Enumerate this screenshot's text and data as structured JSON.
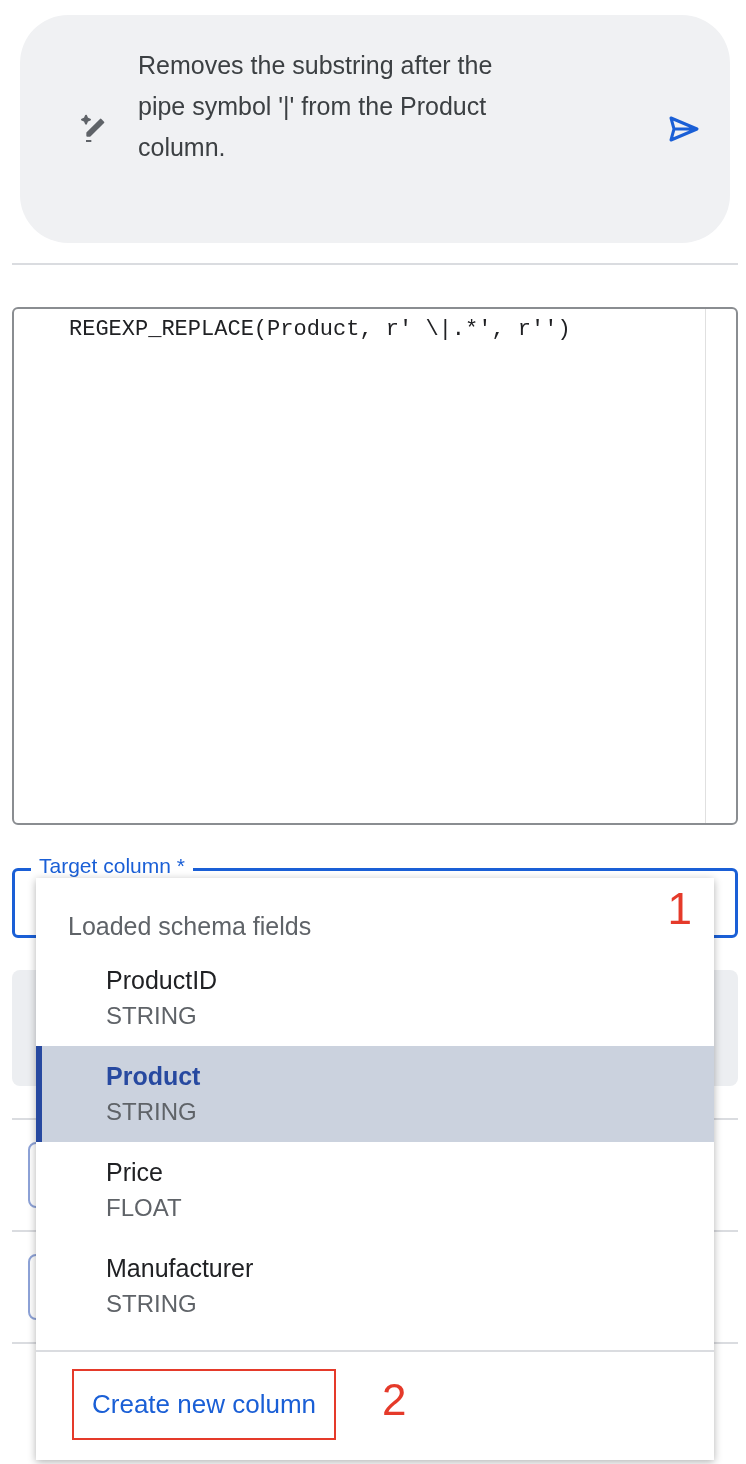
{
  "prompt": {
    "text": "Removes the substring after the pipe symbol '|' from the Product column."
  },
  "editor": {
    "code": "REGEXP_REPLACE(Product, r' \\|.*', r'')"
  },
  "target_column": {
    "label": "Target column *",
    "focused": true
  },
  "dropdown": {
    "header": "Loaded schema fields",
    "items": [
      {
        "name": "ProductID",
        "type": "STRING",
        "selected": false
      },
      {
        "name": "Product",
        "type": "STRING",
        "selected": true
      },
      {
        "name": "Price",
        "type": "FLOAT",
        "selected": false
      },
      {
        "name": "Manufacturer",
        "type": "STRING",
        "selected": false
      }
    ],
    "action": "Create new column"
  },
  "annotations": [
    "1",
    "2"
  ]
}
